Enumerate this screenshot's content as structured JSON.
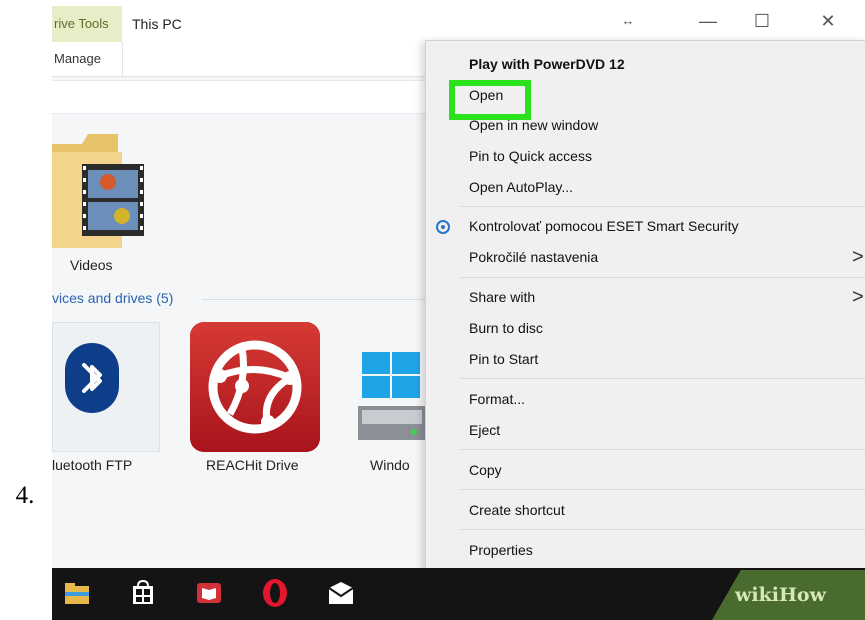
{
  "step": "4.",
  "titlebar": {
    "drive_tools_tab": "rive Tools",
    "title": "This PC",
    "manage_tab": "Manage"
  },
  "window_controls": {
    "pin": "↔",
    "minimize": "—",
    "maximize": "☐",
    "close": "✕"
  },
  "content": {
    "videos_label": "Videos",
    "devices_header": "vices and drives (5)",
    "bluetooth_label": "luetooth FTP",
    "reachit_label": "REACHit Drive",
    "windows_label": "Windo"
  },
  "context_menu": {
    "items": [
      "Play with PowerDVD 12",
      "Open",
      "Open in new window",
      "Pin to Quick access",
      "Open AutoPlay...",
      "Kontrolovať pomocou ESET Smart Security",
      "Pokročilé nastavenia",
      "Share with",
      "Burn to disc",
      "Pin to Start",
      "Format...",
      "Eject",
      "Copy",
      "Create shortcut",
      "Properties"
    ],
    "submenu_arrow": ">"
  },
  "watermark": {
    "text": "wikiHow"
  },
  "colors": {
    "highlight": "#29e21c",
    "taskbar": "#141414",
    "reachit_red": "#c9242a",
    "bluetooth_blue": "#0e3d8a",
    "menu_bg": "#f0f0f0"
  }
}
